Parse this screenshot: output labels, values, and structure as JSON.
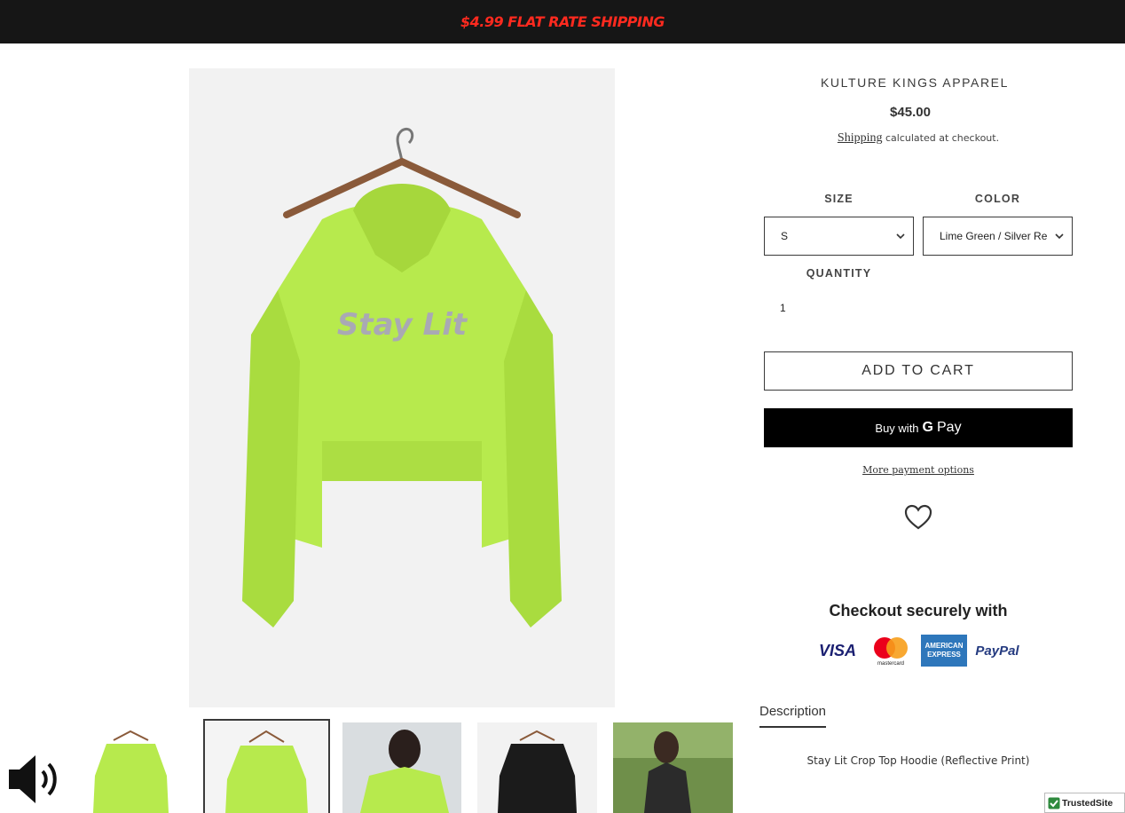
{
  "announcement": {
    "text": "$4.99 FLAT RATE SHIPPING"
  },
  "product": {
    "vendor": "KULTURE KINGS APPAREL",
    "price": "$45.00",
    "shipping_link": "Shipping",
    "shipping_note": "calculated at checkout.",
    "print_text": "Stay Lit"
  },
  "options": {
    "size_label": "SIZE",
    "size_value": "S",
    "color_label": "COLOR",
    "color_value": "Lime Green / Silver Re",
    "quantity_label": "QUANTITY",
    "quantity_value": "1"
  },
  "actions": {
    "add_to_cart": "ADD TO CART",
    "buy_with": "Buy with",
    "gpay_g": "G",
    "gpay_pay": "Pay",
    "more_payment": "More payment options"
  },
  "checkout": {
    "title": "Checkout securely with",
    "cards": [
      "VISA",
      "mastercard",
      "AMERICAN EXPRESS",
      "PayPal"
    ]
  },
  "description": {
    "tab": "Description",
    "text": "Stay Lit Crop Top Hoodie (Reflective Print)"
  },
  "trust_badge": "TrustedSite",
  "colors": {
    "accent_red": "#ff2a1f",
    "lime": "#b7ea4d",
    "dark": "#161616"
  },
  "icons": [
    "speaker-icon",
    "heart-icon",
    "chevron-down-icon",
    "check-icon"
  ]
}
